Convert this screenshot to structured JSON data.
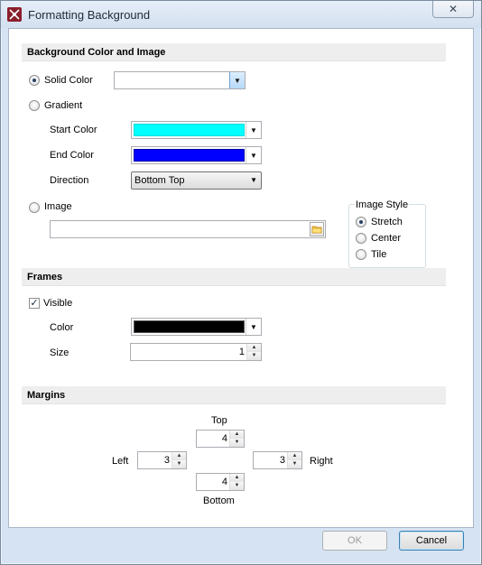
{
  "window": {
    "title": "Formatting Background",
    "close_glyph": "✕"
  },
  "background": {
    "header": "Background Color and Image",
    "solid_color_label": "Solid Color",
    "solid_color_value": "#ffffff",
    "gradient_label": "Gradient",
    "start_color_label": "Start Color",
    "start_color_value": "#00ffff",
    "end_color_label": "End Color",
    "end_color_value": "#0000ff",
    "direction_label": "Direction",
    "direction_value": "Bottom Top",
    "image_label": "Image",
    "image_path": "",
    "image_style": {
      "legend": "Image Style",
      "options": [
        "Stretch",
        "Center",
        "Tile"
      ],
      "selected": "Stretch"
    },
    "selected_mode": "Solid Color"
  },
  "frames": {
    "header": "Frames",
    "visible_label": "Visible",
    "visible_checked": true,
    "color_label": "Color",
    "color_value": "#000000",
    "size_label": "Size",
    "size_value": "1"
  },
  "margins": {
    "header": "Margins",
    "top_label": "Top",
    "top_value": "4",
    "left_label": "Left",
    "left_value": "3",
    "right_label": "Right",
    "right_value": "3",
    "bottom_label": "Bottom",
    "bottom_value": "4"
  },
  "footer": {
    "ok_label": "OK",
    "cancel_label": "Cancel"
  },
  "glyphs": {
    "dropdown_arrow": "▼",
    "spin_up": "▲",
    "spin_down": "▼",
    "check": "✓"
  }
}
